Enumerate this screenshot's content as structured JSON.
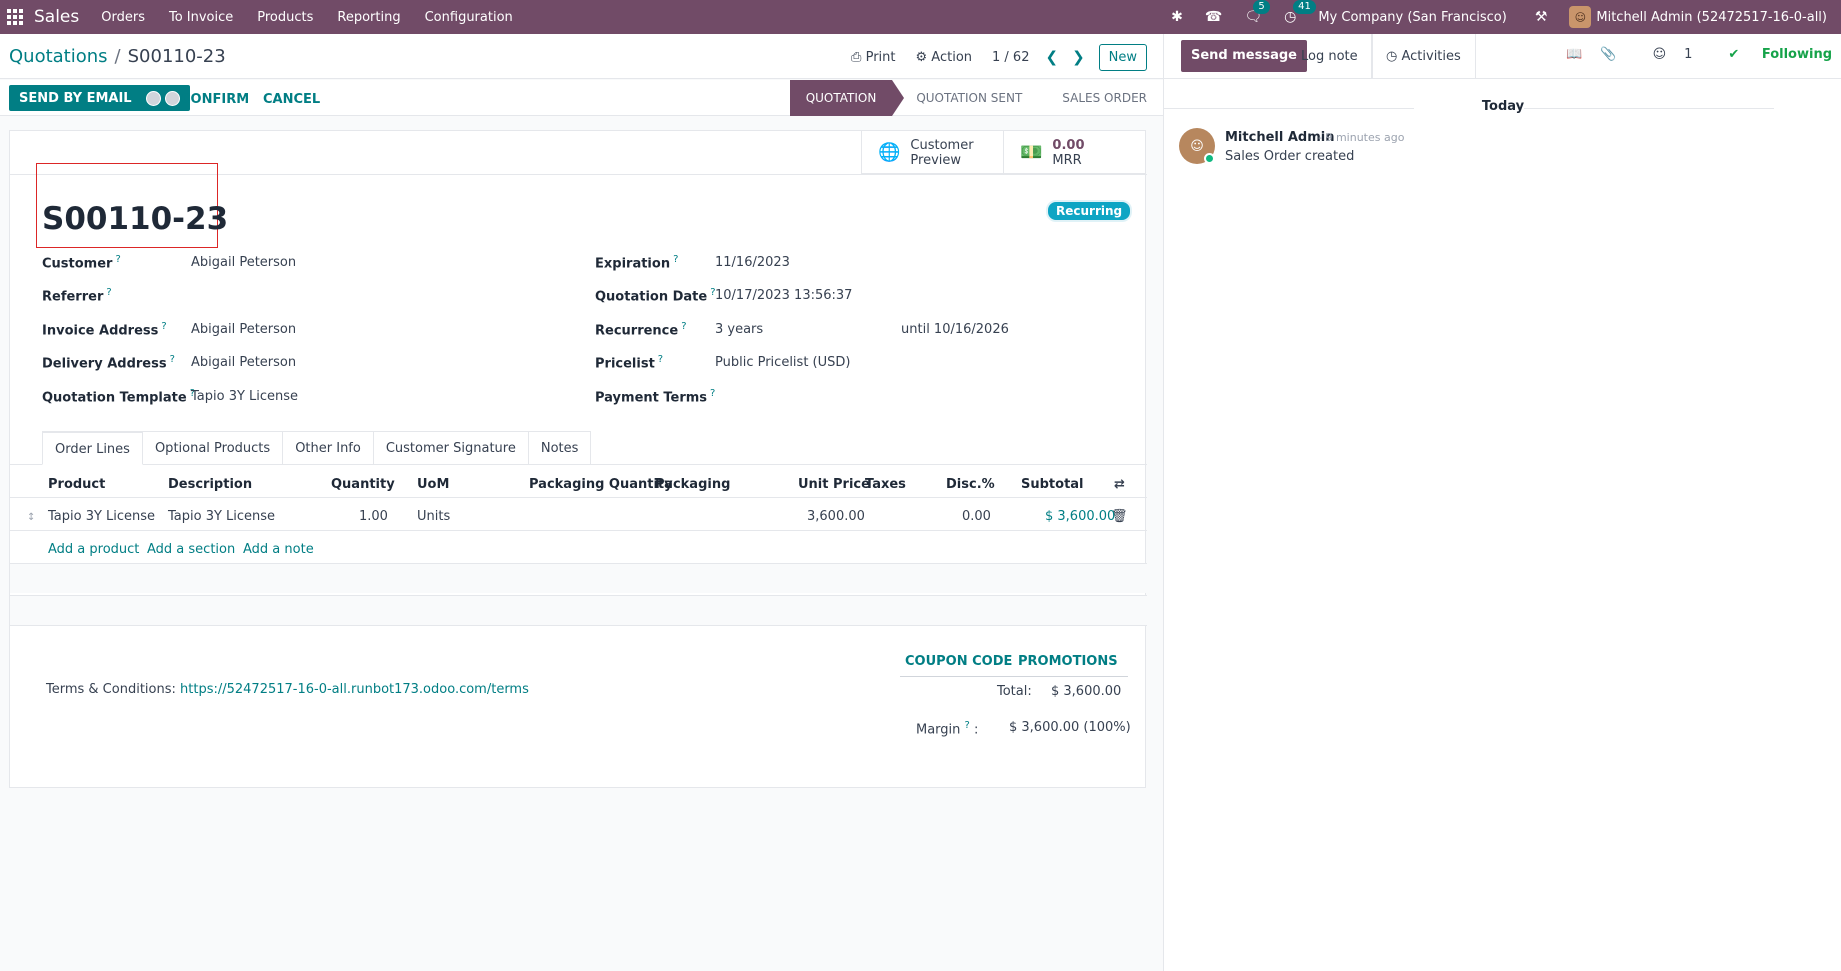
{
  "navbar": {
    "brand": "Sales",
    "menus": [
      "Orders",
      "To Invoice",
      "Products",
      "Reporting",
      "Configuration"
    ],
    "messages_badge": "5",
    "activities_badge": "41",
    "company": "My Company (San Francisco)",
    "user": "Mitchell Admin (52472517-16-0-all)"
  },
  "control_panel": {
    "breadcrumb_parent": "Quotations",
    "breadcrumb_current": "S00110-23",
    "print_label": "Print",
    "action_label": "Action",
    "pager": "1 / 62",
    "new_label": "New"
  },
  "buttons": {
    "send_by_email": "SEND BY EMAIL",
    "confirm": "CONFIRM",
    "cancel": "CANCEL"
  },
  "statusbar": [
    "QUOTATION",
    "QUOTATION SENT",
    "SALES ORDER"
  ],
  "stat_buttons": {
    "preview_line1": "Customer",
    "preview_line2": "Preview",
    "mrr_value": "0.00",
    "mrr_label": "MRR"
  },
  "order": {
    "name": "S00110-23",
    "tag": "Recurring"
  },
  "fields": {
    "customer_label": "Customer",
    "customer": "Abigail Peterson",
    "referrer_label": "Referrer",
    "invoice_address_label": "Invoice Address",
    "invoice_address": "Abigail Peterson",
    "delivery_address_label": "Delivery Address",
    "delivery_address": "Abigail Peterson",
    "template_label": "Quotation Template",
    "template": "Tapio 3Y License",
    "expiration_label": "Expiration",
    "expiration": "11/16/2023",
    "quotation_date_label": "Quotation Date",
    "quotation_date": "10/17/2023 13:56:37",
    "recurrence_label": "Recurrence",
    "recurrence": "3 years",
    "recurrence_until": "until  10/16/2026",
    "pricelist_label": "Pricelist",
    "pricelist": "Public Pricelist (USD)",
    "payment_terms_label": "Payment Terms",
    "help_mark": "?"
  },
  "tabs": [
    "Order Lines",
    "Optional Products",
    "Other Info",
    "Customer Signature",
    "Notes"
  ],
  "table": {
    "headers": [
      "Product",
      "Description",
      "Quantity",
      "UoM",
      "Packaging Quantity",
      "Packaging",
      "Unit Price",
      "Taxes",
      "Disc.%",
      "Subtotal"
    ],
    "rows": [
      {
        "product": "Tapio 3Y License",
        "description": "Tapio 3Y License",
        "quantity": "1.00",
        "uom": "Units",
        "unit_price": "3,600.00",
        "discount": "0.00",
        "subtotal": "$ 3,600.00"
      }
    ],
    "add_product": "Add a product",
    "add_section": "Add a section",
    "add_note": "Add a note"
  },
  "footer": {
    "coupon_code": "COUPON CODE",
    "promotions": "PROMOTIONS",
    "terms_label": "Terms & Conditions:",
    "terms_link": "https://52472517-16-0-all.runbot173.odoo.com/terms",
    "total_label": "Total:",
    "total_value": "$ 3,600.00",
    "margin_label": "Margin",
    "margin_value": "$ 3,600.00 (100%)"
  },
  "chatter": {
    "send_message": "Send message",
    "log_note": "Log note",
    "activities": "Activities",
    "followers_count": "1",
    "following": "Following",
    "today": "Today",
    "author": "Mitchell Admin",
    "time": "- 9 minutes ago",
    "body": "Sales Order created"
  },
  "colors": {
    "brand": "#714b67",
    "accent": "#017e84",
    "highlight": "#dc2626"
  }
}
